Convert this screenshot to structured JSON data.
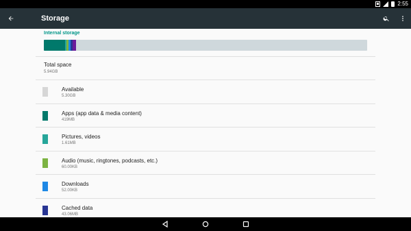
{
  "status_bar": {
    "time": "2:55"
  },
  "toolbar": {
    "title": "Storage"
  },
  "section": {
    "header": "Internal storage"
  },
  "usage_bar": {
    "segments": [
      {
        "name": "apps",
        "fraction": 0.066,
        "color": "#00796b"
      },
      {
        "name": "pictures",
        "fraction": 0.004,
        "color": "#26a69a"
      },
      {
        "name": "audio",
        "fraction": 0.006,
        "color": "#7cb342"
      },
      {
        "name": "downloads",
        "fraction": 0.006,
        "color": "#1e88e5"
      },
      {
        "name": "cached",
        "fraction": 0.006,
        "color": "#283593"
      },
      {
        "name": "misc",
        "fraction": 0.012,
        "color": "#6a1b9a"
      }
    ],
    "remaining_color": "#cfd8dc"
  },
  "total": {
    "title": "Total space",
    "value": "5.94GB"
  },
  "items": [
    {
      "title": "Available",
      "value": "5.30GB",
      "color": "#d6d6d6"
    },
    {
      "title": "Apps (app data & media content)",
      "value": "419MB",
      "color": "#00796b"
    },
    {
      "title": "Pictures, videos",
      "value": "1.61MB",
      "color": "#26a69a"
    },
    {
      "title": "Audio (music, ringtones, podcasts, etc.)",
      "value": "60.00KB",
      "color": "#7cb342"
    },
    {
      "title": "Downloads",
      "value": "52.00KB",
      "color": "#1e88e5"
    },
    {
      "title": "Cached data",
      "value": "43.06MB",
      "color": "#283593"
    }
  ],
  "icons": {
    "back": "arrow-back-icon",
    "search": "search-icon",
    "more": "more-vert-icon",
    "nav_back": "nav-back-icon",
    "nav_home": "nav-home-icon",
    "nav_recents": "nav-recents-icon"
  }
}
